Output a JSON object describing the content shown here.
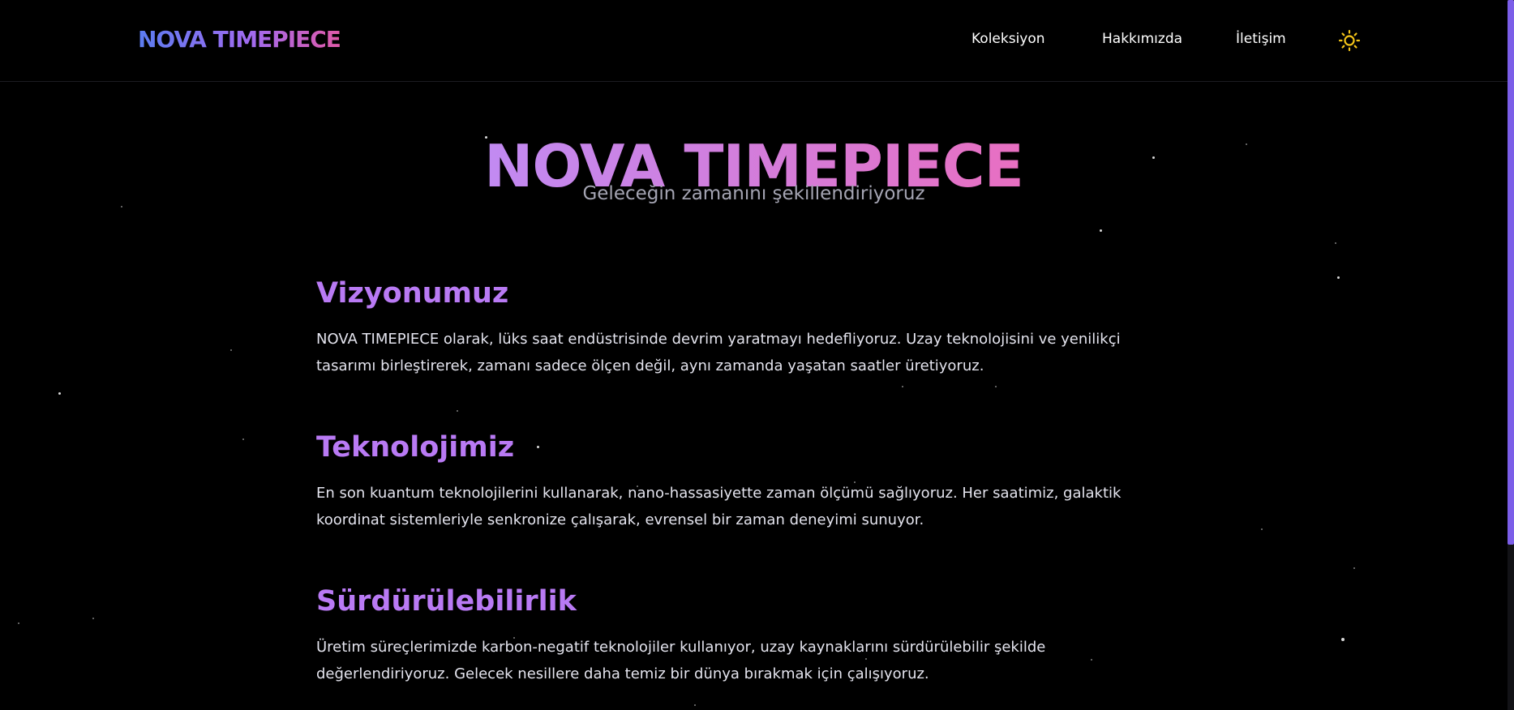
{
  "header": {
    "logo": "NOVA TIMEPIECE",
    "nav": {
      "collection": "Koleksiyon",
      "about": "Hakkımızda",
      "contact": "İletişim"
    },
    "theme_toggle_icon": "sun-icon"
  },
  "hero": {
    "title": "NOVA TIMEPIECE",
    "subtitle": "Geleceğin zamanını şekillendiriyoruz"
  },
  "sections": [
    {
      "title": "Vizyonumuz",
      "body": "NOVA TIMEPIECE olarak, lüks saat endüstrisinde devrim yaratmayı hedefliyoruz. Uzay teknolojisini ve yenilikçi tasarımı birleştirerek, zamanı sadece ölçen değil, aynı zamanda yaşatan saatler üretiyoruz."
    },
    {
      "title": "Teknolojimiz",
      "body": "En son kuantum teknolojilerini kullanarak, nano-hassasiyette zaman ölçümü sağlıyoruz. Her saatimiz, galaktik koordinat sistemleriyle senkronize çalışarak, evrensel bir zaman deneyimi sunuyor."
    },
    {
      "title": "Sürdürülebilirlik",
      "body": "Üretim süreçlerimizde karbon-negatif teknolojiler kullanıyor, uzay kaynaklarını sürdürülebilir şekilde değerlendiriyoruz. Gelecek nesillere daha temiz bir dünya bırakmak için çalışıyoruz."
    }
  ],
  "colors": {
    "background": "#000000",
    "logo_gradient_start": "#5b7cf0",
    "logo_gradient_end": "#e05aa8",
    "section_heading": "#b97af4",
    "sun_icon": "#f5c518",
    "scrollbar_thumb": "#7b5ee8"
  }
}
